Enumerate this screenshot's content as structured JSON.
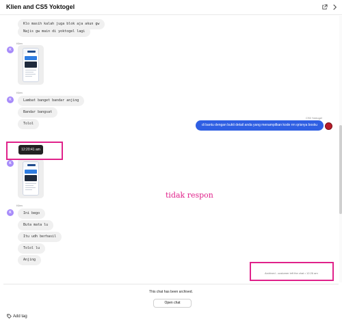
{
  "header": {
    "title": "Klien and CS5 Yoktogel",
    "link_icon": "external-link-icon",
    "close_icon": "collapse-icon"
  },
  "customer": {
    "initial": "K",
    "name": "Klien"
  },
  "messages_top": [
    "Klo masih kalah juga blok aja akun gw",
    "Najis gw main di yoktogel lagi"
  ],
  "messages_mid": [
    "Lambat banget bandar anjing",
    "Bandar bangsat",
    "Tolol"
  ],
  "agent": {
    "name": "CS5 Yoktogel",
    "message": "di bantu dengan bukti detail anda yang menampilkan kode rrn qrisnya bosku"
  },
  "tooltip_time": "12:20:41 am",
  "messages_bottom": [
    "Ini bego",
    "Buta mata lu",
    "Itu udh berhasil",
    "Tolol lu",
    "Anjing"
  ],
  "annotation": "tidak respon",
  "archived_note": "Archived - customer left the chat • 12:26 am",
  "footer": {
    "archived_message": "This chat has been archived.",
    "open_chat_label": "Open chat",
    "add_tag_label": "Add tag"
  },
  "colors": {
    "accent": "#2f5fe3",
    "annotation": "#e0218a",
    "avatar": "#a78bfa"
  }
}
